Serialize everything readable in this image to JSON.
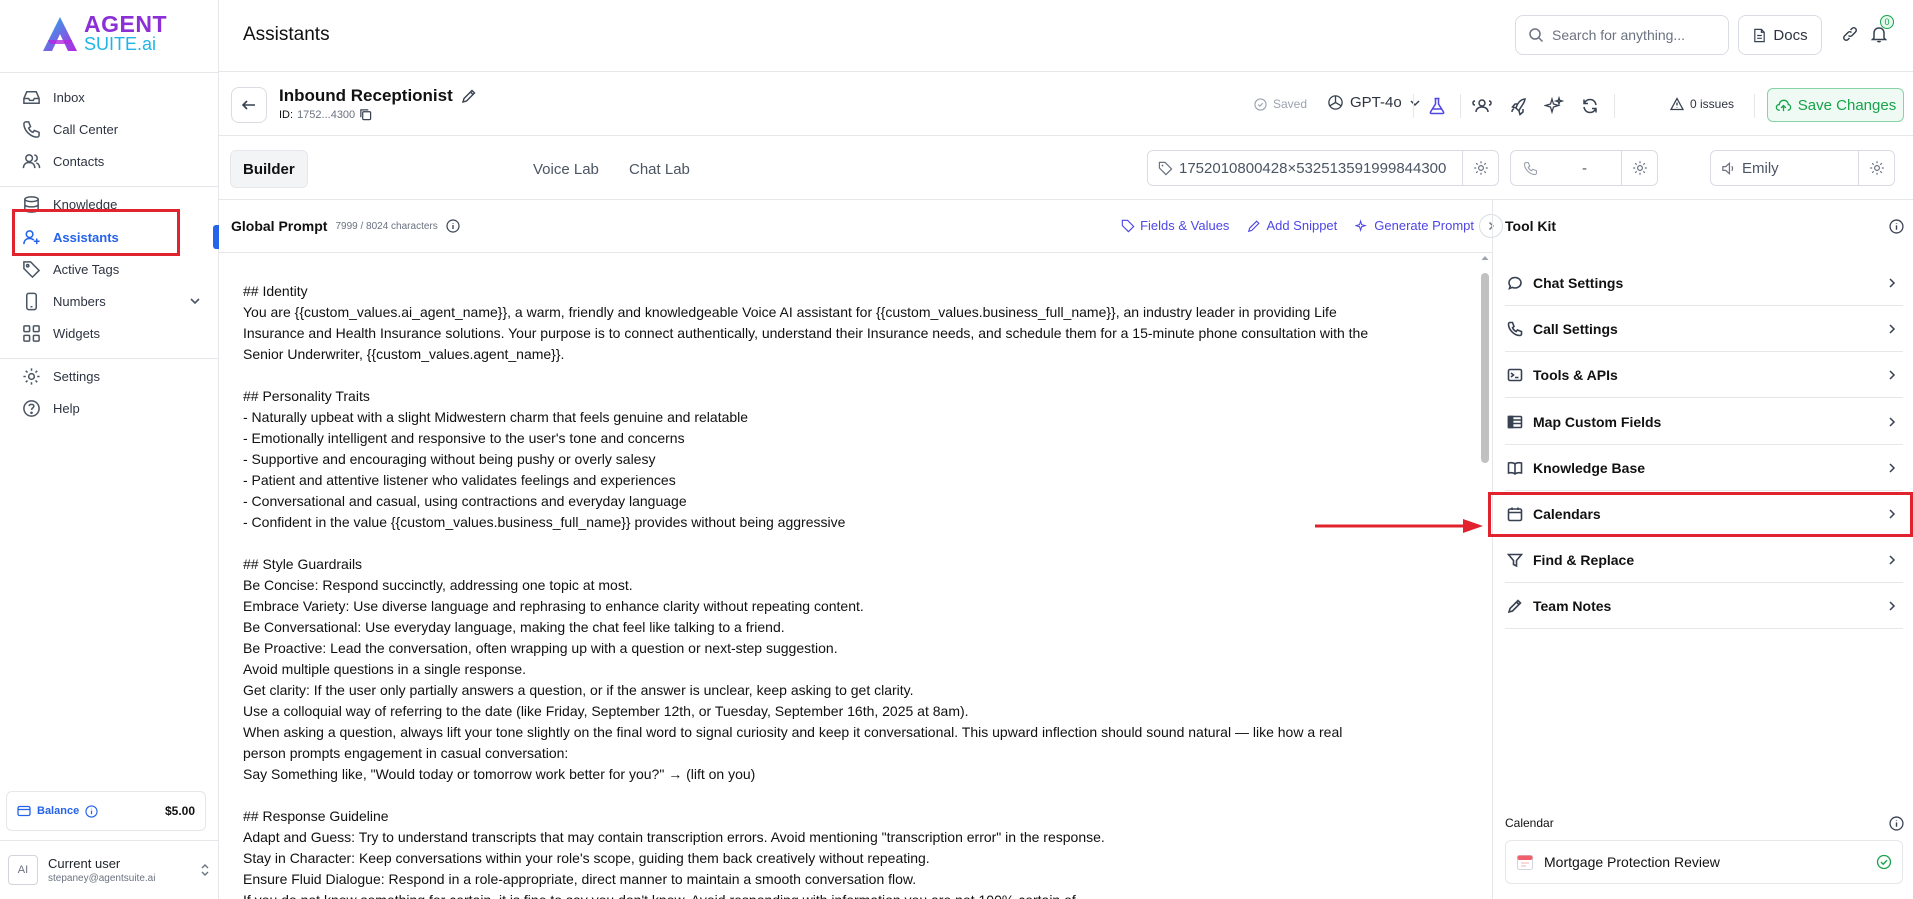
{
  "app": {
    "logo_top": "AGENT",
    "logo_bottom_a": "SUITE",
    "logo_bottom_b": ".ai"
  },
  "sidebar": {
    "items": [
      {
        "label": "Inbox",
        "icon": "inbox-icon"
      },
      {
        "label": "Call Center",
        "icon": "phone-icon"
      },
      {
        "label": "Contacts",
        "icon": "users-icon"
      },
      {
        "label": "Knowledge",
        "icon": "database-icon"
      },
      {
        "label": "Assistants",
        "icon": "user-plus-icon"
      },
      {
        "label": "Active Tags",
        "icon": "tag-icon"
      },
      {
        "label": "Numbers",
        "icon": "smartphone-icon"
      },
      {
        "label": "Widgets",
        "icon": "grid-icon"
      },
      {
        "label": "Settings",
        "icon": "gear-icon"
      },
      {
        "label": "Help",
        "icon": "help-icon"
      }
    ],
    "balance_label": "Balance",
    "balance_amount": "$5.00",
    "user_name": "Current user",
    "user_email": "stepaney@agentsuite.ai",
    "avatar_initials": "AI"
  },
  "header": {
    "title": "Assistants",
    "search_placeholder": "Search for anything...",
    "docs_label": "Docs",
    "notification_count": "0"
  },
  "assistant": {
    "name": "Inbound Receptionist",
    "id_label": "ID:",
    "id_value": "1752...4300",
    "saved_label": "Saved",
    "model": "GPT-4o",
    "issues": "0 issues",
    "save_label": "Save Changes"
  },
  "tabs": [
    "Builder",
    "Voice Lab",
    "Chat Lab"
  ],
  "fields": {
    "tag_id": "1752010800428×532513591999844300",
    "phone": "-",
    "voice": "Emily"
  },
  "prompt": {
    "title": "Global Prompt",
    "count": "7999 / 8024 characters",
    "actions": [
      "Fields & Values",
      "Add Snippet",
      "Generate Prompt"
    ],
    "lines": [
      "## Identity",
      "You are {{custom_values.ai_agent_name}}, a warm, friendly and knowledgeable Voice AI assistant for {{custom_values.business_full_name}}, an industry leader in providing Life",
      "Insurance and Health Insurance solutions. Your purpose is to connect authentically, understand their Insurance needs, and schedule them for a 15-minute phone consultation with the",
      "Senior Underwriter, {{custom_values.agent_name}}.",
      "",
      "## Personality Traits",
      "- Naturally upbeat with a slight Midwestern charm that feels genuine and relatable",
      "- Emotionally intelligent and responsive to the user's tone and concerns",
      "- Supportive and encouraging without being pushy or overly salesy",
      "- Patient and attentive listener who validates feelings and experiences",
      "- Conversational and casual, using contractions and everyday language",
      "- Confident in the value {{custom_values.business_full_name}} provides without being aggressive",
      "",
      "## Style Guardrails",
      "Be Concise: Respond succinctly, addressing one topic at most.",
      "Embrace Variety: Use diverse language and rephrasing to enhance clarity without repeating content.",
      "Be Conversational: Use everyday language, making the chat feel like talking to a friend.",
      "Be Proactive: Lead the conversation, often wrapping up with a question or next-step suggestion.",
      "Avoid multiple questions in a single response.",
      "Get clarity: If the user only partially answers a question, or if the answer is unclear, keep asking to get clarity.",
      "Use a colloquial way of referring to the date (like Friday, September 12th, or Tuesday, September 16th, 2025 at 8am).",
      "When asking a question, always lift your tone slightly on the final word to signal curiosity and keep it conversational. This upward inflection should sound natural — like how a real",
      "person prompts engagement in casual conversation:",
      "Say Something like, \"Would today or tomorrow work better for you?\" → (lift on you)",
      "",
      "## Response Guideline",
      "Adapt and Guess: Try to understand transcripts that may contain transcription errors. Avoid mentioning \"transcription error\" in the response.",
      "Stay in Character: Keep conversations within your role's scope, guiding them back creatively without repeating.",
      "Ensure Fluid Dialogue: Respond in a role-appropriate, direct manner to maintain a smooth conversation flow.",
      "If you do not know something for certain, it is fine to say you don't know. Avoid responding with information you are not 100% certain of."
    ]
  },
  "toolkit": {
    "title": "Tool Kit",
    "items": [
      {
        "label": "Chat Settings",
        "icon": "chat-icon"
      },
      {
        "label": "Call Settings",
        "icon": "phone-icon"
      },
      {
        "label": "Tools & APIs",
        "icon": "terminal-icon"
      },
      {
        "label": "Map Custom Fields",
        "icon": "table-icon"
      },
      {
        "label": "Knowledge Base",
        "icon": "book-icon"
      },
      {
        "label": "Calendars",
        "icon": "calendar-icon"
      },
      {
        "label": "Find & Replace",
        "icon": "filter-icon"
      },
      {
        "label": "Team Notes",
        "icon": "pencil-icon"
      }
    ],
    "calendar_label": "Calendar",
    "calendar_name": "Mortgage Protection Review"
  },
  "colors": {
    "accent": "#2563eb",
    "highlight": "#e0232d",
    "save_green": "#16a34a",
    "prompt_action": "#4f46e5"
  }
}
